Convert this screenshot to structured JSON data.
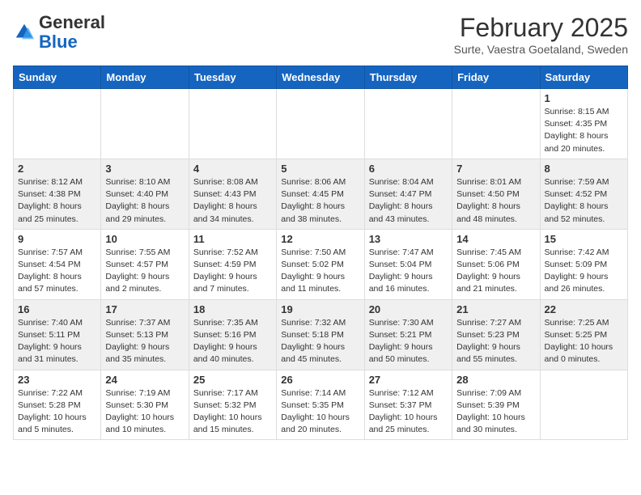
{
  "logo": {
    "general": "General",
    "blue": "Blue"
  },
  "header": {
    "month": "February 2025",
    "location": "Surte, Vaestra Goetaland, Sweden"
  },
  "weekdays": [
    "Sunday",
    "Monday",
    "Tuesday",
    "Wednesday",
    "Thursday",
    "Friday",
    "Saturday"
  ],
  "weeks": [
    [
      {
        "day": "",
        "info": ""
      },
      {
        "day": "",
        "info": ""
      },
      {
        "day": "",
        "info": ""
      },
      {
        "day": "",
        "info": ""
      },
      {
        "day": "",
        "info": ""
      },
      {
        "day": "",
        "info": ""
      },
      {
        "day": "1",
        "info": "Sunrise: 8:15 AM\nSunset: 4:35 PM\nDaylight: 8 hours and 20 minutes."
      }
    ],
    [
      {
        "day": "2",
        "info": "Sunrise: 8:12 AM\nSunset: 4:38 PM\nDaylight: 8 hours and 25 minutes."
      },
      {
        "day": "3",
        "info": "Sunrise: 8:10 AM\nSunset: 4:40 PM\nDaylight: 8 hours and 29 minutes."
      },
      {
        "day": "4",
        "info": "Sunrise: 8:08 AM\nSunset: 4:43 PM\nDaylight: 8 hours and 34 minutes."
      },
      {
        "day": "5",
        "info": "Sunrise: 8:06 AM\nSunset: 4:45 PM\nDaylight: 8 hours and 38 minutes."
      },
      {
        "day": "6",
        "info": "Sunrise: 8:04 AM\nSunset: 4:47 PM\nDaylight: 8 hours and 43 minutes."
      },
      {
        "day": "7",
        "info": "Sunrise: 8:01 AM\nSunset: 4:50 PM\nDaylight: 8 hours and 48 minutes."
      },
      {
        "day": "8",
        "info": "Sunrise: 7:59 AM\nSunset: 4:52 PM\nDaylight: 8 hours and 52 minutes."
      }
    ],
    [
      {
        "day": "9",
        "info": "Sunrise: 7:57 AM\nSunset: 4:54 PM\nDaylight: 8 hours and 57 minutes."
      },
      {
        "day": "10",
        "info": "Sunrise: 7:55 AM\nSunset: 4:57 PM\nDaylight: 9 hours and 2 minutes."
      },
      {
        "day": "11",
        "info": "Sunrise: 7:52 AM\nSunset: 4:59 PM\nDaylight: 9 hours and 7 minutes."
      },
      {
        "day": "12",
        "info": "Sunrise: 7:50 AM\nSunset: 5:02 PM\nDaylight: 9 hours and 11 minutes."
      },
      {
        "day": "13",
        "info": "Sunrise: 7:47 AM\nSunset: 5:04 PM\nDaylight: 9 hours and 16 minutes."
      },
      {
        "day": "14",
        "info": "Sunrise: 7:45 AM\nSunset: 5:06 PM\nDaylight: 9 hours and 21 minutes."
      },
      {
        "day": "15",
        "info": "Sunrise: 7:42 AM\nSunset: 5:09 PM\nDaylight: 9 hours and 26 minutes."
      }
    ],
    [
      {
        "day": "16",
        "info": "Sunrise: 7:40 AM\nSunset: 5:11 PM\nDaylight: 9 hours and 31 minutes."
      },
      {
        "day": "17",
        "info": "Sunrise: 7:37 AM\nSunset: 5:13 PM\nDaylight: 9 hours and 35 minutes."
      },
      {
        "day": "18",
        "info": "Sunrise: 7:35 AM\nSunset: 5:16 PM\nDaylight: 9 hours and 40 minutes."
      },
      {
        "day": "19",
        "info": "Sunrise: 7:32 AM\nSunset: 5:18 PM\nDaylight: 9 hours and 45 minutes."
      },
      {
        "day": "20",
        "info": "Sunrise: 7:30 AM\nSunset: 5:21 PM\nDaylight: 9 hours and 50 minutes."
      },
      {
        "day": "21",
        "info": "Sunrise: 7:27 AM\nSunset: 5:23 PM\nDaylight: 9 hours and 55 minutes."
      },
      {
        "day": "22",
        "info": "Sunrise: 7:25 AM\nSunset: 5:25 PM\nDaylight: 10 hours and 0 minutes."
      }
    ],
    [
      {
        "day": "23",
        "info": "Sunrise: 7:22 AM\nSunset: 5:28 PM\nDaylight: 10 hours and 5 minutes."
      },
      {
        "day": "24",
        "info": "Sunrise: 7:19 AM\nSunset: 5:30 PM\nDaylight: 10 hours and 10 minutes."
      },
      {
        "day": "25",
        "info": "Sunrise: 7:17 AM\nSunset: 5:32 PM\nDaylight: 10 hours and 15 minutes."
      },
      {
        "day": "26",
        "info": "Sunrise: 7:14 AM\nSunset: 5:35 PM\nDaylight: 10 hours and 20 minutes."
      },
      {
        "day": "27",
        "info": "Sunrise: 7:12 AM\nSunset: 5:37 PM\nDaylight: 10 hours and 25 minutes."
      },
      {
        "day": "28",
        "info": "Sunrise: 7:09 AM\nSunset: 5:39 PM\nDaylight: 10 hours and 30 minutes."
      },
      {
        "day": "",
        "info": ""
      }
    ]
  ]
}
